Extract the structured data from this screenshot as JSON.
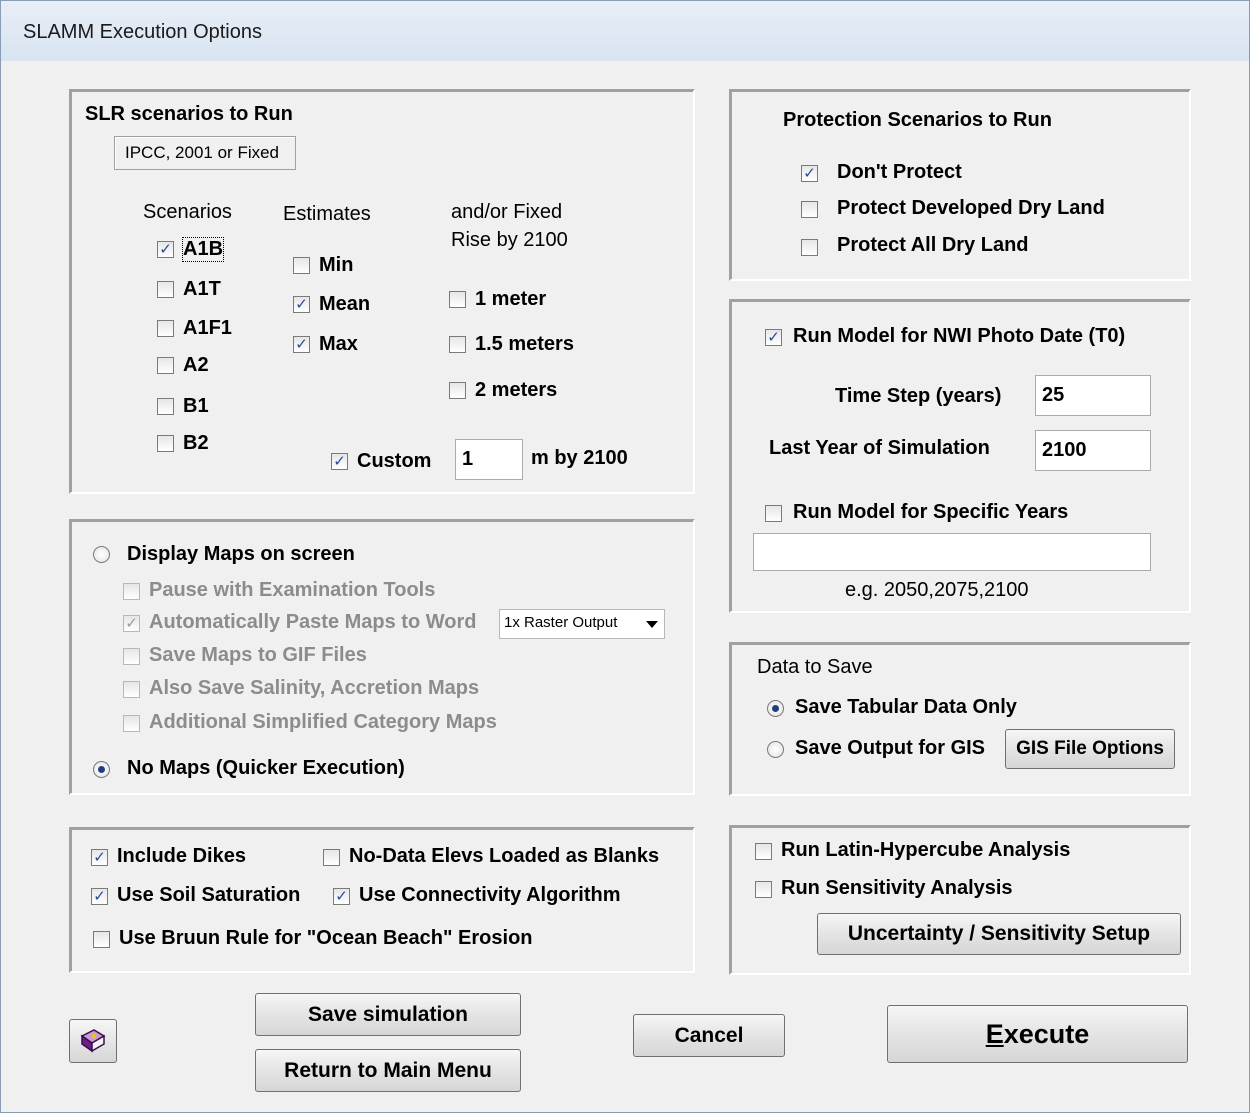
{
  "window": {
    "title": "SLAMM Execution Options"
  },
  "slr": {
    "title": "SLR scenarios to Run",
    "source_box": "IPCC, 2001 or Fixed",
    "scenarios_header": "Scenarios",
    "estimates_header": "Estimates",
    "fixed_header_1": "and/or Fixed",
    "fixed_header_2": "Rise by 2100",
    "scenarios": [
      {
        "label": "A1B",
        "checked": true
      },
      {
        "label": "A1T",
        "checked": false
      },
      {
        "label": "A1F1",
        "checked": false
      },
      {
        "label": "A2",
        "checked": false
      },
      {
        "label": "B1",
        "checked": false
      },
      {
        "label": "B2",
        "checked": false
      }
    ],
    "estimates": [
      {
        "label": "Min",
        "checked": false
      },
      {
        "label": "Mean",
        "checked": true
      },
      {
        "label": "Max",
        "checked": true
      }
    ],
    "fixed": [
      {
        "label": "1 meter",
        "checked": false
      },
      {
        "label": "1.5 meters",
        "checked": false
      },
      {
        "label": "2 meters",
        "checked": false
      }
    ],
    "custom_label": "Custom",
    "custom_checked": true,
    "custom_value": "1",
    "custom_suffix": "m  by 2100"
  },
  "maps": {
    "display_label": "Display Maps on screen",
    "display_selected": false,
    "options": [
      {
        "label": "Pause with Examination Tools",
        "checked": false
      },
      {
        "label": "Automatically Paste Maps to Word",
        "checked": true
      },
      {
        "label": "Save Maps to GIF Files",
        "checked": false
      },
      {
        "label": "Also Save Salinity, Accretion Maps",
        "checked": false
      },
      {
        "label": "Additional Simplified Category Maps",
        "checked": false
      }
    ],
    "raster_select": "1x Raster Output",
    "no_maps_label": "No Maps (Quicker Execution)",
    "no_maps_selected": true
  },
  "flags": {
    "include_dikes": {
      "label": "Include Dikes",
      "checked": true
    },
    "no_data_elevs": {
      "label": "No-Data Elevs Loaded as Blanks",
      "checked": false
    },
    "soil_saturation": {
      "label": "Use Soil Saturation",
      "checked": true
    },
    "connectivity": {
      "label": "Use Connectivity Algorithm",
      "checked": true
    },
    "bruun": {
      "label": "Use Bruun Rule for \"Ocean Beach\" Erosion",
      "checked": false
    }
  },
  "protection": {
    "title": "Protection Scenarios to Run",
    "items": [
      {
        "label": "Don't Protect",
        "checked": true
      },
      {
        "label": "Protect Developed Dry Land",
        "checked": false
      },
      {
        "label": "Protect All Dry Land",
        "checked": false
      }
    ]
  },
  "timing": {
    "run_t0_label": "Run Model for NWI Photo Date (T0)",
    "run_t0_checked": true,
    "time_step_label": "Time Step (years)",
    "time_step_value": "25",
    "last_year_label": "Last Year of Simulation",
    "last_year_value": "2100",
    "specific_label": "Run Model for Specific Years",
    "specific_checked": false,
    "specific_value": "",
    "example": "e.g. 2050,2075,2100"
  },
  "save": {
    "title": "Data to Save",
    "tabular_label": "Save Tabular Data Only",
    "tabular_selected": true,
    "gis_label": "Save Output for GIS",
    "gis_selected": false,
    "gis_button": "GIS File Options"
  },
  "analysis": {
    "latin_label": "Run Latin-Hypercube Analysis",
    "latin_checked": false,
    "sensitivity_label": "Run Sensitivity Analysis",
    "sensitivity_checked": false,
    "setup_button": "Uncertainty / Sensitivity Setup"
  },
  "buttons": {
    "save_sim": "Save simulation",
    "return_menu": "Return to Main Menu",
    "cancel": "Cancel",
    "execute_first": "E",
    "execute_rest": "xecute"
  },
  "icons": {
    "help": "help-book-icon",
    "check": "checkmark-icon"
  }
}
